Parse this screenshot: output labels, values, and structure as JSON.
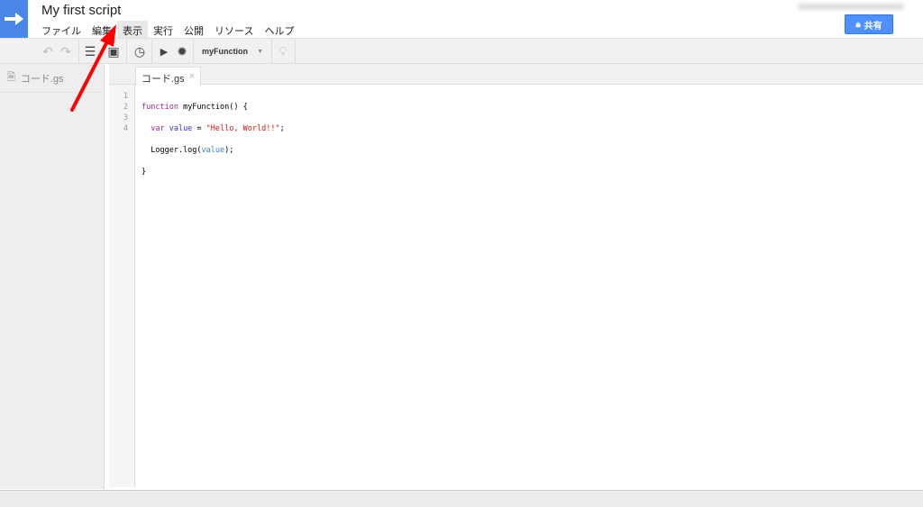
{
  "header": {
    "title": "My first script",
    "share_label": "共有"
  },
  "menu": [
    "ファイル",
    "編集",
    "表示",
    "実行",
    "公開",
    "リソース",
    "ヘルプ"
  ],
  "toolbar": {
    "function_select": "myFunction"
  },
  "sidebar": {
    "file": "コード.gs"
  },
  "editor": {
    "tab": "コード.gs",
    "line_numbers": [
      "1",
      "2",
      "3",
      "4"
    ]
  },
  "code": {
    "l1a": "function",
    "l1b": " myFunction() {",
    "l2a": "  var",
    "l2b": " value",
    "l2c": " = ",
    "l2d": "\"Hello, World!!\"",
    "l2e": ";",
    "l3a": "  Logger.log(",
    "l3b": "value",
    "l3c": ");",
    "l4": "}"
  },
  "colors": {
    "accent": "#4a86e8",
    "arrow": "#ff0000"
  }
}
